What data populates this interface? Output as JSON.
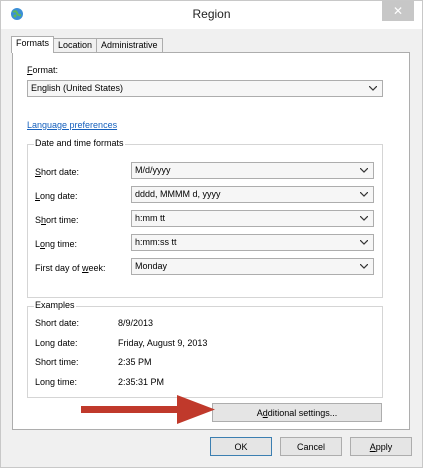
{
  "window": {
    "title": "Region",
    "close_glyph": "✕",
    "icon": "globe-icon"
  },
  "tabs": [
    {
      "label": "Formats",
      "active": true
    },
    {
      "label": "Location",
      "active": false
    },
    {
      "label": "Administrative",
      "active": false
    }
  ],
  "format": {
    "label": "Format:",
    "value": "English (United States)"
  },
  "language_link": "Language preferences",
  "date_time": {
    "group_title": "Date and time formats",
    "rows": [
      {
        "label": "Short date:",
        "value": "M/d/yyyy"
      },
      {
        "label": "Long date:",
        "value": "dddd, MMMM d, yyyy"
      },
      {
        "label": "Short time:",
        "value": "h:mm tt"
      },
      {
        "label": "Long time:",
        "value": "h:mm:ss tt"
      },
      {
        "label": "First day of week:",
        "value": "Monday"
      }
    ]
  },
  "examples": {
    "group_title": "Examples",
    "rows": [
      {
        "label": "Short date:",
        "value": "8/9/2013"
      },
      {
        "label": "Long date:",
        "value": "Friday, August 9, 2013"
      },
      {
        "label": "Short time:",
        "value": "2:35 PM"
      },
      {
        "label": "Long time:",
        "value": "2:35:31 PM"
      }
    ]
  },
  "additional_settings_label": "Additional settings...",
  "footer": {
    "ok": "OK",
    "cancel": "Cancel",
    "apply": "Apply"
  },
  "colors": {
    "arrow": "#c0392b",
    "link": "#1560bd"
  }
}
